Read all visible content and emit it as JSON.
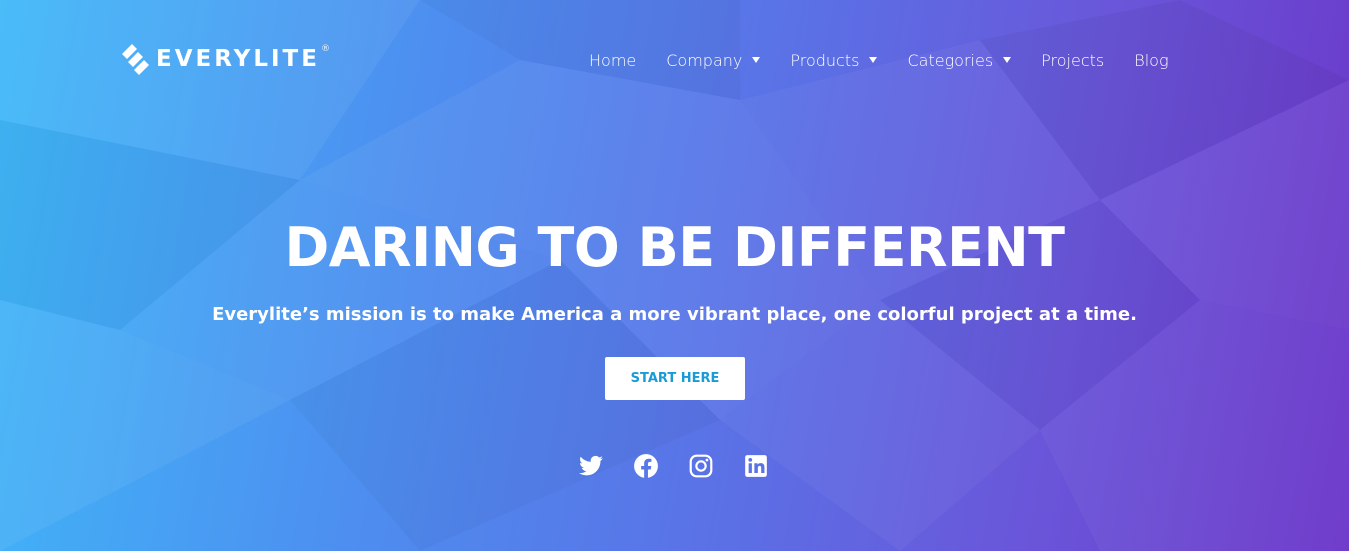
{
  "brand": {
    "name": "EVERYLITE",
    "registered": "®"
  },
  "nav": {
    "items": [
      {
        "label": "Home",
        "dropdown": false
      },
      {
        "label": "Company",
        "dropdown": true
      },
      {
        "label": "Products",
        "dropdown": true
      },
      {
        "label": "Categories",
        "dropdown": true
      },
      {
        "label": "Projects",
        "dropdown": false
      },
      {
        "label": "Blog",
        "dropdown": false
      }
    ]
  },
  "hero": {
    "headline": "DARING TO BE DIFFERENT",
    "tagline": "Everylite’s mission is to make America a more vibrant place, one colorful project at a time.",
    "cta_label": "START HERE"
  },
  "social": [
    "twitter-icon",
    "facebook-icon",
    "instagram-icon",
    "linkedin-icon"
  ],
  "colors": {
    "gradient_start": "#3fb8f8",
    "gradient_end": "#6b36c8",
    "cta_text": "#1a9bd8",
    "text": "#ffffff"
  }
}
